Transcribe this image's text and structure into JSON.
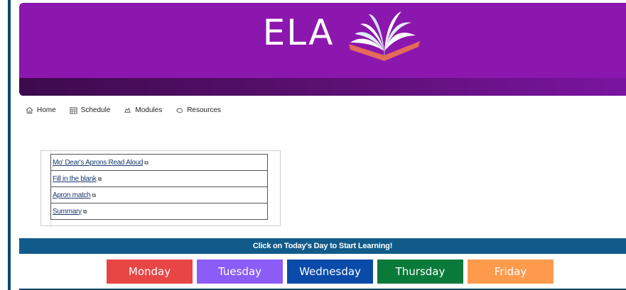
{
  "banner": {
    "title": "ELA",
    "icon": "open-book-icon"
  },
  "nav": {
    "items": [
      {
        "label": "Home",
        "icon": "home-icon"
      },
      {
        "label": "Schedule",
        "icon": "calendar-icon"
      },
      {
        "label": "Modules",
        "icon": "modules-icon"
      },
      {
        "label": "Resources",
        "icon": "resources-icon"
      }
    ]
  },
  "links": [
    {
      "label": "Mo' Dear's Aprons Read Aloud",
      "icon": "external-link-icon"
    },
    {
      "label": "Fill in the blank",
      "icon": "external-link-icon"
    },
    {
      "label": "Apron match",
      "icon": "external-link-icon"
    },
    {
      "label": "Summary",
      "icon": "external-link-icon"
    }
  ],
  "cta": {
    "text": "Click on Today's Day to Start Learning!"
  },
  "days": [
    {
      "label": "Monday",
      "color": "#e84545"
    },
    {
      "label": "Tuesday",
      "color": "#8b5cf6"
    },
    {
      "label": "Wednesday",
      "color": "#0a4aa8"
    },
    {
      "label": "Thursday",
      "color": "#0a7a3a"
    },
    {
      "label": "Friday",
      "color": "#ff9a4d"
    }
  ],
  "colors": {
    "banner": "#8b17ae",
    "cta_bar": "#115b8b"
  }
}
